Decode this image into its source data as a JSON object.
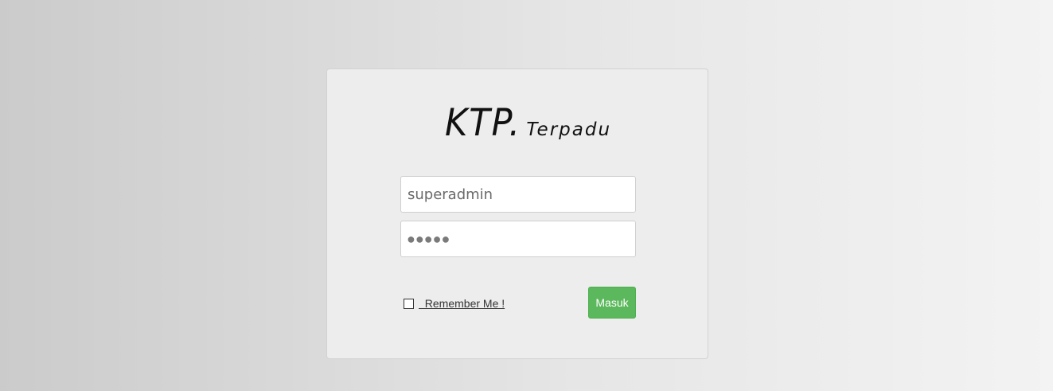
{
  "logo": {
    "main": "KTP.",
    "sub": "Terpadu"
  },
  "login": {
    "username_value": "superadmin",
    "password_mask": "●●●●●",
    "remember_label": "  Remember Me !",
    "submit_label": "Masuk"
  },
  "colors": {
    "button": "#5cb85c",
    "card": "#ededed"
  }
}
